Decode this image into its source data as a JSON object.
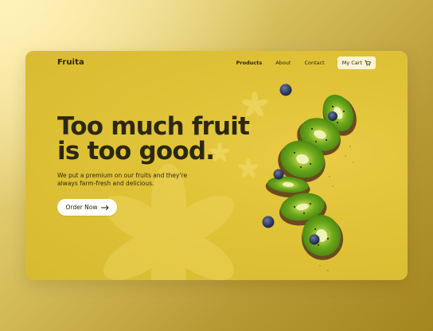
{
  "brand": {
    "name": "Fruita"
  },
  "nav": {
    "items": [
      {
        "label": "Products",
        "active": true
      },
      {
        "label": "About"
      },
      {
        "label": "Contact"
      }
    ],
    "cart_label": "My Cart",
    "cart_icon": "shopping-cart-icon"
  },
  "hero": {
    "headline_line1": "Too much fruit",
    "headline_line2": "is too good.",
    "subtext": "We put a premium on our fruits and they're always farm-fresh and delicious.",
    "cta_label": "Order Now",
    "cta_icon": "arrow-right-icon"
  },
  "colors": {
    "card_bg": "#e1c338",
    "text_dark": "#2c2810",
    "cart_bg": "#fbf4d2",
    "kiwi_flesh": "#6fae1f",
    "kiwi_skin": "#7a5a2a",
    "blueberry": "#3a4870"
  }
}
